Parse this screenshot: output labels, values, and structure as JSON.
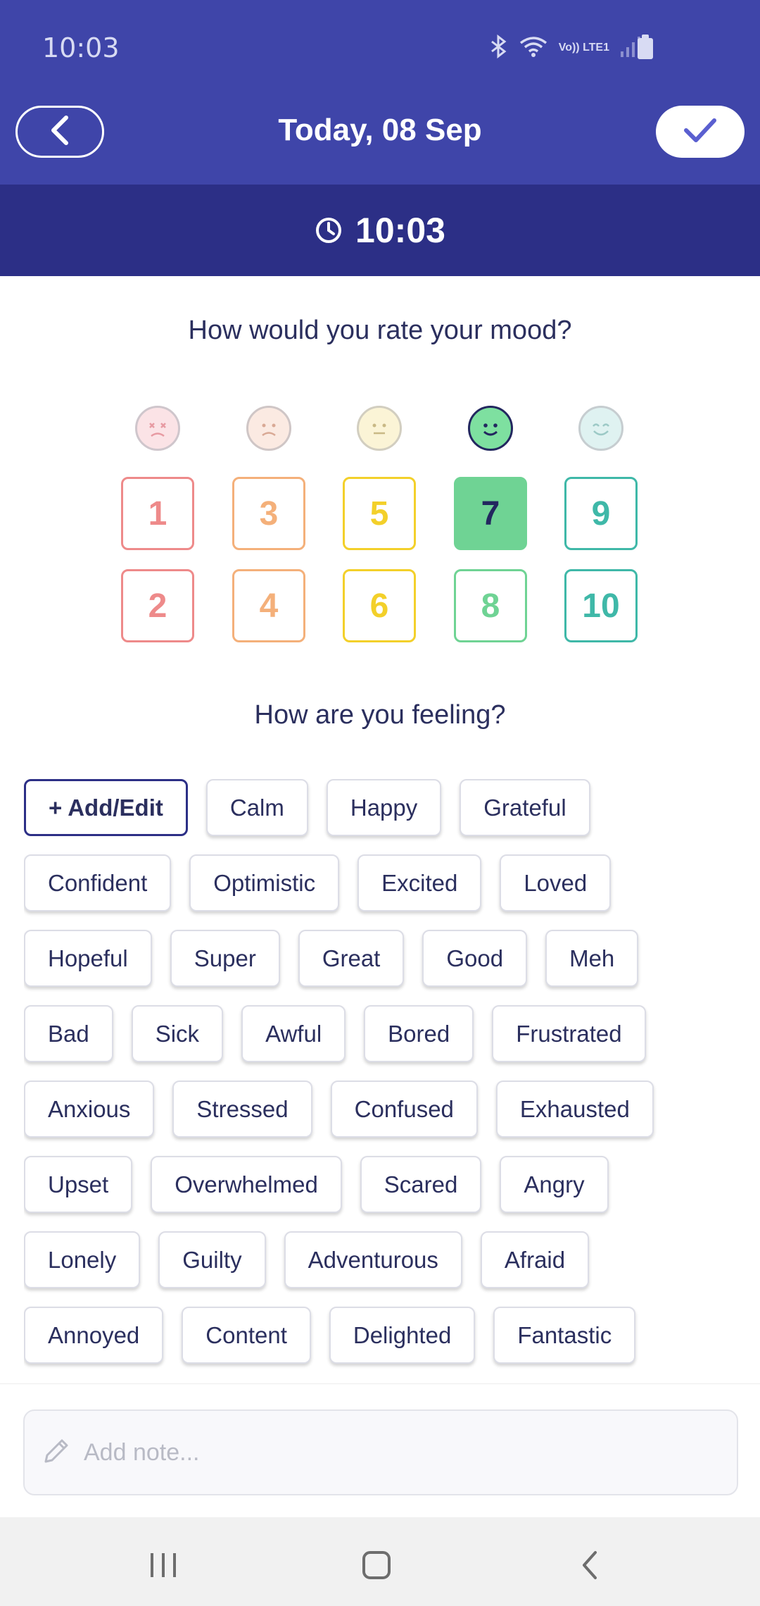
{
  "status_bar": {
    "time": "10:03",
    "network_label": "Vo)) LTE1"
  },
  "header": {
    "title": "Today, 08 Sep",
    "back_icon": "chevron-left-icon",
    "save_icon": "check-icon"
  },
  "time_bar": {
    "time": "10:03",
    "icon": "clock-icon"
  },
  "mood": {
    "question": "How would you rate your mood?",
    "selected": "7",
    "faces": [
      "very-sad-face-icon",
      "sad-face-icon",
      "neutral-face-icon",
      "smile-face-icon",
      "happy-face-icon"
    ],
    "top_row": [
      "1",
      "3",
      "5",
      "7",
      "9"
    ],
    "bottom_row": [
      "2",
      "4",
      "6",
      "8",
      "10"
    ],
    "colors": {
      "red": "#ee8a8a",
      "orange": "#f4b07a",
      "yellow": "#f3d02a",
      "green": "#6fd394",
      "teal": "#3fb8a8",
      "selected_fill": "#6fd394"
    }
  },
  "feelings": {
    "question": "How are you feeling?",
    "add_label": "+ Add/Edit",
    "rows": [
      [
        "Calm",
        "Happy",
        "Grateful"
      ],
      [
        "Confident",
        "Optimistic",
        "Excited",
        "Loved"
      ],
      [
        "Hopeful",
        "Super",
        "Great",
        "Good",
        "Meh"
      ],
      [
        "Bad",
        "Sick",
        "Awful",
        "Bored",
        "Frustrated"
      ],
      [
        "Anxious",
        "Stressed",
        "Confused",
        "Exhausted"
      ],
      [
        "Upset",
        "Overwhelmed",
        "Scared",
        "Angry"
      ],
      [
        "Lonely",
        "Guilty",
        "Adventurous",
        "Afraid"
      ],
      [
        "Annoyed",
        "Content",
        "Delighted",
        "Fantastic"
      ]
    ]
  },
  "note": {
    "placeholder": "Add note...",
    "icon": "pencil-icon"
  },
  "nav": {
    "icons": [
      "recent-apps-icon",
      "home-icon",
      "back-icon"
    ]
  }
}
